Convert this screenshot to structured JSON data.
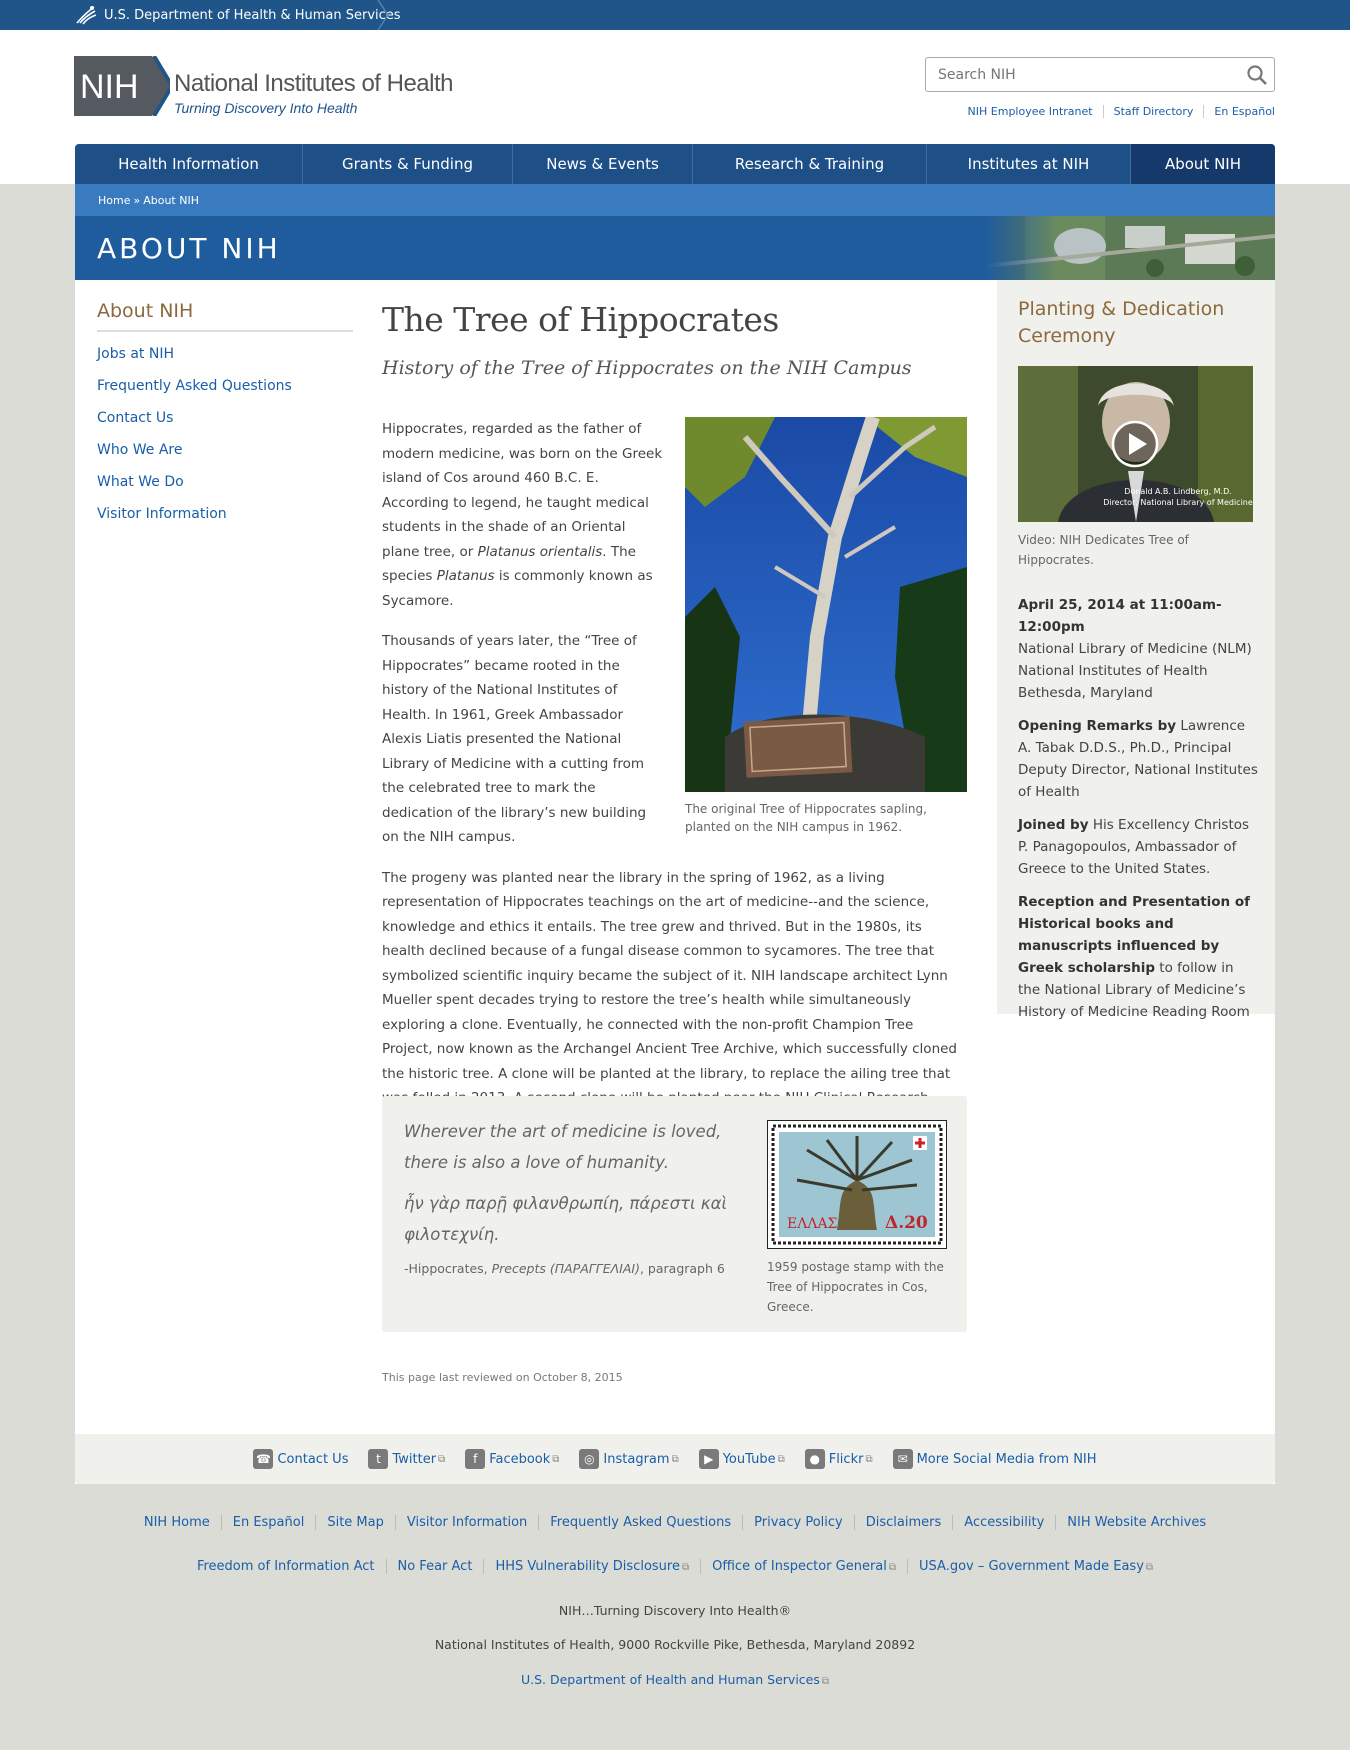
{
  "hhs": {
    "label": "U.S. Department of Health & Human Services"
  },
  "header": {
    "logo_mark": "NIH",
    "logo_title": "National Institutes of Health",
    "logo_tagline": "Turning Discovery Into Health",
    "search_placeholder": "Search NIH",
    "utility_links": [
      "NIH Employee Intranet",
      "Staff Directory",
      "En Español"
    ]
  },
  "nav": {
    "items": [
      {
        "label": "Health Information"
      },
      {
        "label": "Grants & Funding"
      },
      {
        "label": "News & Events"
      },
      {
        "label": "Research & Training"
      },
      {
        "label": "Institutes at NIH"
      },
      {
        "label": "About NIH"
      }
    ],
    "active": "About NIH"
  },
  "breadcrumb": {
    "home": "Home",
    "sep": "»",
    "current": "About NIH"
  },
  "banner": {
    "title": "ABOUT NIH"
  },
  "left_nav": {
    "title": "About NIH",
    "items": [
      "Jobs at NIH",
      "Frequently Asked Questions",
      "Contact Us",
      "Who We Are",
      "What We Do",
      "Visitor Information"
    ]
  },
  "article": {
    "title": "The Tree of Hippocrates",
    "subtitle": "History of the Tree of Hippocrates on the NIH Campus",
    "p1_a": "Hippocrates, regarded as the father of modern medicine, was born on the Greek island of Cos around 460 B.C. E. According to legend, he taught medical students in the shade of an Oriental plane tree, or ",
    "p1_b": "Platanus orientalis",
    "p1_c": ". The species ",
    "p1_d": "Platanus",
    "p1_e": " is commonly known as Sycamore.",
    "p2": "Thousands of years later, the “Tree of Hippocrates” became rooted in the history of the National Institutes of Health. In 1961, Greek Ambassador Alexis Liatis presented the National Library of Medicine with a cutting from the celebrated tree to mark the dedication of the library’s new building on the NIH campus.",
    "p3": "The progeny was planted near the library in the spring of 1962, as a living representation of Hippocrates teachings on the art of medicine--and the science, knowledge and ethics it entails. The tree grew and thrived. But in the 1980s, its health declined because of a fungal disease common to sycamores.  The tree that symbolized scientific inquiry became the subject of it. NIH landscape architect Lynn Mueller spent decades trying to restore the tree’s health while simultaneously exploring a clone. Eventually, he connected with the non-profit Champion Tree Project, now known as the Archangel Ancient Tree Archive, which successfully cloned the historic tree. A clone will be planted at the library, to replace the ailing tree that was felled in 2013. A second clone will be planted near the NIH Clinical Research Center.",
    "tree_caption": "The original Tree of Hippocrates sapling, planted on the NIH campus in 1962.",
    "quote_en": "Wherever the art of medicine is loved, there is also a love of humanity.",
    "quote_gr": "ἦν γὰρ παρῇ φιλανθρωπίη, πάρεστι καὶ φιλοτεχνίη.",
    "quote_src_a": "-Hippocrates, ",
    "quote_src_b": "Precepts (ΠΑΡΑΓΓΕΛΙΑΙ)",
    "quote_src_c": ", paragraph 6",
    "stamp_text": "ΕΛΛΑΣ",
    "stamp_value": "Δ.20",
    "stamp_caption": "1959 postage stamp with the Tree of Hippocrates in Cos, Greece.",
    "reviewed": "This page last reviewed on October 8, 2015"
  },
  "sidebar": {
    "title": "Planting & Dedication Ceremony",
    "video_overlay_name": "Donald A.B. Lindberg, M.D.",
    "video_overlay_role": "Director, National Library of Medicine",
    "video_caption": "Video: NIH Dedicates Tree of Hippocrates.",
    "date": "April 25, 2014 at 11:00am-12:00pm",
    "location": [
      "National Library of Medicine (NLM)",
      "National Institutes of Health",
      "Bethesda, Maryland"
    ],
    "remarks_label": "Opening Remarks by",
    "remarks_text": " Lawrence A. Tabak D.D.S., Ph.D., Principal Deputy Director, National Institutes of Health",
    "joined_label": "Joined by",
    "joined_text": " His Excellency Christos P. Panagopoulos, Ambassador of Greece to the United States.",
    "reception_label": "Reception and Presentation of Historical books and manuscripts influenced by Greek scholarship",
    "reception_text": " to follow in the National Library of Medicine’s History of Medicine Reading Room"
  },
  "social": [
    {
      "label": "Contact Us",
      "icon": "phone-icon",
      "external": false
    },
    {
      "label": "Twitter",
      "icon": "twitter-icon",
      "external": true
    },
    {
      "label": "Facebook",
      "icon": "facebook-icon",
      "external": true
    },
    {
      "label": "Instagram",
      "icon": "instagram-icon",
      "external": true
    },
    {
      "label": "YouTube",
      "icon": "youtube-icon",
      "external": true
    },
    {
      "label": "Flickr",
      "icon": "flickr-icon",
      "external": true
    },
    {
      "label": "More Social Media from NIH",
      "icon": "social-media-icon",
      "external": false
    }
  ],
  "footer": {
    "row1": [
      "NIH Home",
      "En Español",
      "Site Map",
      "Visitor Information",
      "Frequently Asked Questions",
      "Privacy Policy",
      "Disclaimers",
      "Accessibility",
      "NIH Website Archives"
    ],
    "row2": [
      "Freedom of Information Act",
      "No Fear Act",
      "HHS Vulnerability Disclosure",
      "Office of Inspector General",
      "USA.gov – Government Made Easy"
    ],
    "tagline": "NIH…Turning Discovery Into Health®",
    "address": "National Institutes of Health, 9000 Rockville Pike, Bethesda, Maryland 20892",
    "hhs_link": "U.S. Department of Health and Human Services"
  },
  "colors": {
    "nav": "#1e4f86",
    "banner": "#1f5c9e",
    "link": "#1a5ea8",
    "heading_brown": "#8b6a3e"
  }
}
